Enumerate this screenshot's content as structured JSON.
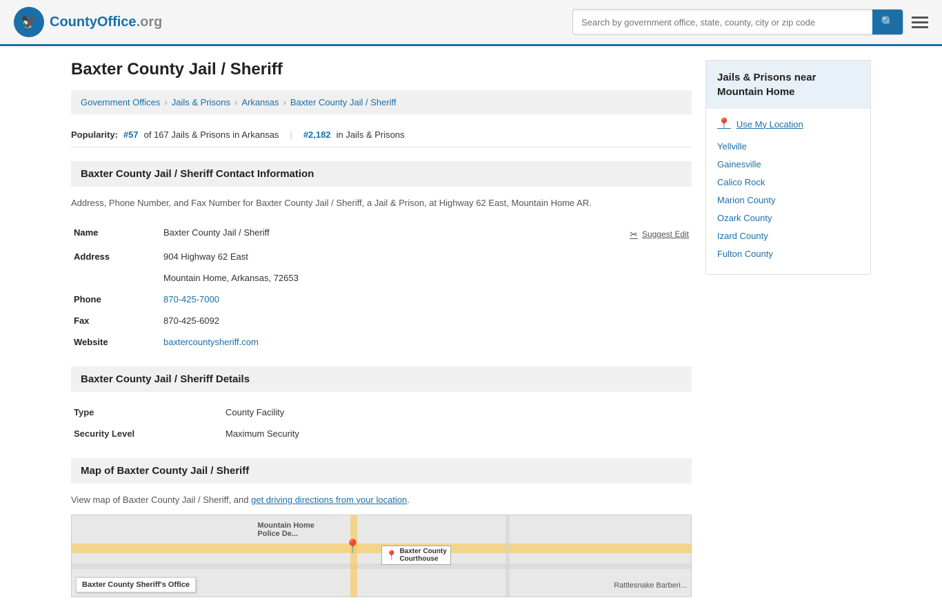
{
  "header": {
    "logo_text": "CountyOffice",
    "logo_suffix": ".org",
    "search_placeholder": "Search by government office, state, county, city or zip code"
  },
  "page": {
    "title": "Baxter County Jail / Sheriff"
  },
  "breadcrumb": {
    "items": [
      {
        "label": "Government Offices",
        "href": "#"
      },
      {
        "label": "Jails & Prisons",
        "href": "#"
      },
      {
        "label": "Arkansas",
        "href": "#"
      },
      {
        "label": "Baxter County Jail / Sheriff",
        "href": "#"
      }
    ]
  },
  "popularity": {
    "label": "Popularity:",
    "rank": "#57",
    "rank_context": "of 167 Jails & Prisons in Arkansas",
    "rank2": "#2,182",
    "rank2_context": "in Jails & Prisons"
  },
  "contact_section": {
    "title": "Baxter County Jail / Sheriff Contact Information",
    "desc": "Address, Phone Number, and Fax Number for Baxter County Jail / Sheriff, a Jail & Prison, at Highway 62 East, Mountain Home AR.",
    "suggest_edit": "Suggest Edit",
    "fields": {
      "name_label": "Name",
      "name_value": "Baxter County Jail / Sheriff",
      "address_label": "Address",
      "address_line1": "904 Highway 62 East",
      "address_line2": "Mountain Home, Arkansas, 72653",
      "phone_label": "Phone",
      "phone_value": "870-425-7000",
      "fax_label": "Fax",
      "fax_value": "870-425-6092",
      "website_label": "Website",
      "website_value": "baxtercountysheriff.com"
    }
  },
  "details_section": {
    "title": "Baxter County Jail / Sheriff Details",
    "fields": {
      "type_label": "Type",
      "type_value": "County Facility",
      "security_label": "Security Level",
      "security_value": "Maximum Security"
    }
  },
  "map_section": {
    "title": "Map of Baxter County Jail / Sheriff",
    "desc_pre": "View map of Baxter County Jail / Sheriff, and ",
    "desc_link": "get driving directions from your location",
    "desc_post": ".",
    "map_label1": "Baxter County Sheriff's Office",
    "map_label2": "Baxter County\nCourthouse",
    "map_label3": "Mountain Home\nPolice De...",
    "map_label4": "Rattlesnake Barberi..."
  },
  "sidebar": {
    "title": "Jails & Prisons near Mountain Home",
    "use_location_label": "Use My Location",
    "links": [
      {
        "label": "Yellville"
      },
      {
        "label": "Gainesville"
      },
      {
        "label": "Calico Rock"
      },
      {
        "label": "Marion County"
      },
      {
        "label": "Ozark County"
      },
      {
        "label": "Izard County"
      },
      {
        "label": "Fulton County"
      }
    ]
  }
}
